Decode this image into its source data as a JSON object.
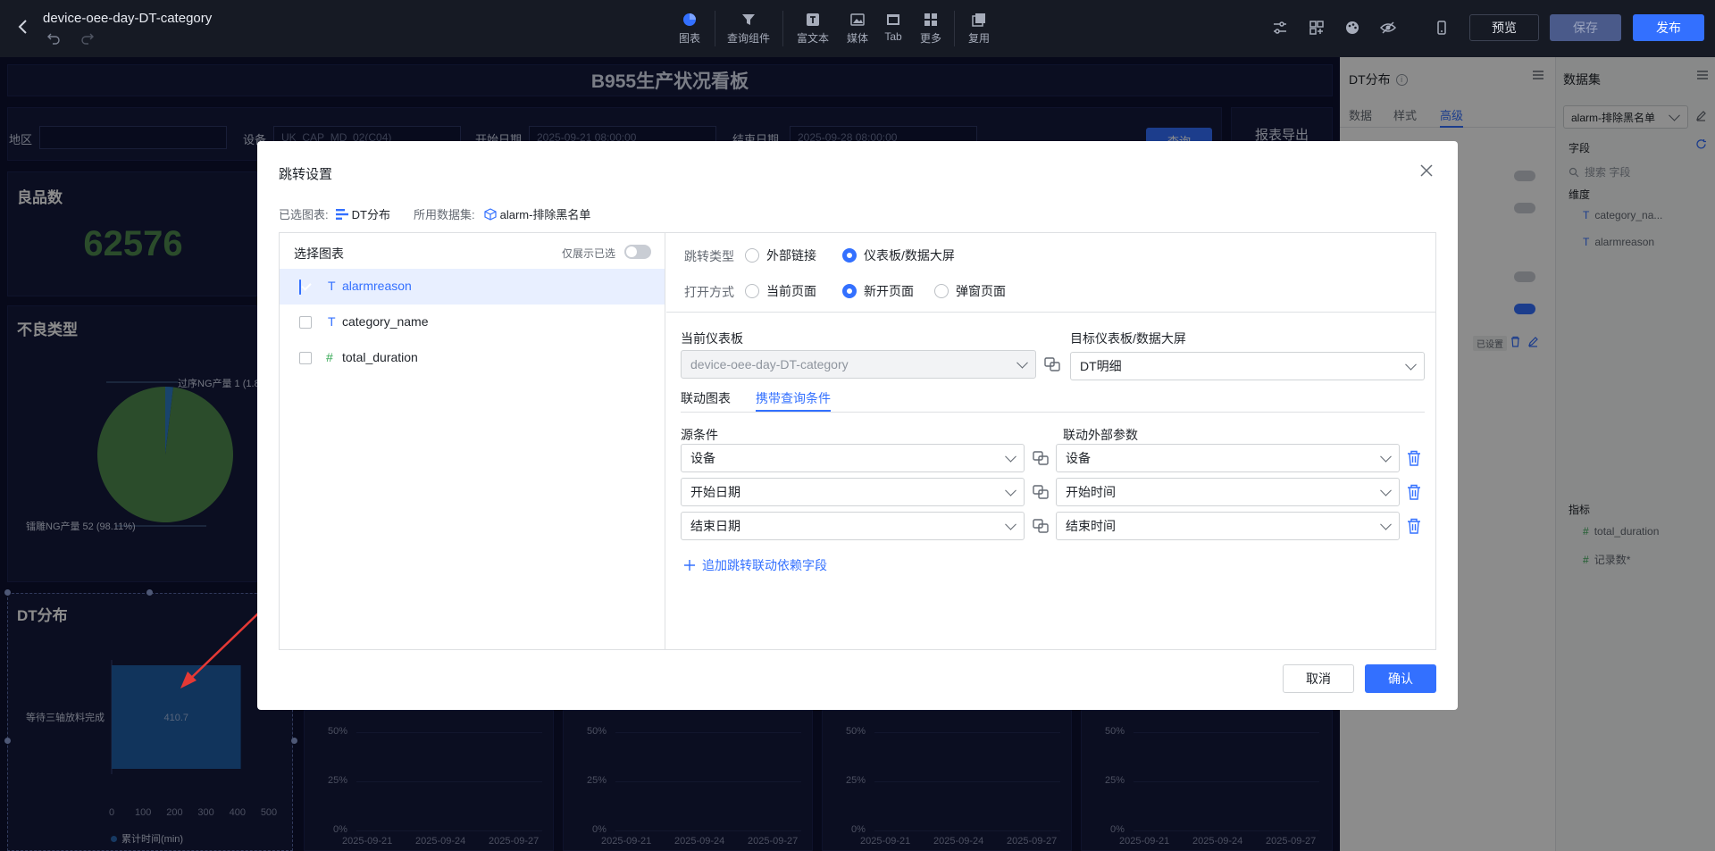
{
  "header": {
    "title": "device-oee-day-DT-category",
    "tools": [
      {
        "label": "图表",
        "icon": "chart-icon"
      },
      {
        "label": "查询组件",
        "icon": "filter-icon"
      },
      {
        "label": "富文本",
        "icon": "richtext-icon"
      },
      {
        "label": "媒体",
        "icon": "media-icon"
      },
      {
        "label": "Tab",
        "icon": "tab-icon"
      },
      {
        "label": "更多",
        "icon": "more-grid-icon"
      },
      {
        "label": "复用",
        "icon": "reuse-icon"
      }
    ],
    "preview_label": "预览",
    "save_label": "保存",
    "publish_label": "发布"
  },
  "dashboard": {
    "title": "B955生产状况看板",
    "filters": {
      "region_label": "地区",
      "device_label": "设备",
      "device_value": "UK_CAP_MD_02(C04)",
      "start_label": "开始日期",
      "start_value": "2025-09-21 08:00:00",
      "end_label": "结束日期",
      "end_value": "2025-09-28 08:00:00",
      "query_label": "查询",
      "export_label": "报表导出"
    },
    "good_count": {
      "title": "良品数",
      "value": "62576"
    },
    "defect_type": {
      "title": "不良类型",
      "label_top": "过序NG产量 1 (1.8",
      "label_bottom": "镭雕NG产量 52 (98.11%)"
    },
    "dt_dist": {
      "title": "DT分布",
      "category": "等待三轴放料完成",
      "value_label": "410.7",
      "legend": "累计时间(min)"
    },
    "small_charts": {
      "yticks": [
        "50%",
        "25%",
        "0%"
      ],
      "xticks": [
        "2025-09-21",
        "2025-09-24",
        "2025-09-27"
      ]
    }
  },
  "chart_data": [
    {
      "type": "bar",
      "title": "DT分布",
      "categories": [
        "等待三轴放料完成"
      ],
      "series": [
        {
          "name": "累计时间(min)",
          "values": [
            410.7
          ]
        }
      ],
      "xlim": [
        0,
        500
      ],
      "xticks": [
        "0",
        "100",
        "200",
        "300",
        "400",
        "500"
      ],
      "orientation": "horizontal"
    },
    {
      "type": "pie",
      "title": "不良类型",
      "categories": [
        "过序NG产量",
        "镭雕NG产量"
      ],
      "values": [
        1,
        52
      ],
      "colors": [
        "#2f7cc7",
        "#4f8a4f"
      ]
    }
  ],
  "right_panel": {
    "title": "DT分布",
    "tabs": [
      "数据",
      "样式",
      "高级"
    ],
    "active_tab": "高级",
    "set_badge": "已设置"
  },
  "dataset_panel": {
    "title": "数据集",
    "dataset": "alarm-排除黑名单",
    "fields_label": "字段",
    "search_placeholder": "搜索 字段",
    "dimension_label": "维度",
    "dimensions": [
      "category_na...",
      "alarmreason"
    ],
    "metric_label": "指标",
    "metrics": [
      "total_duration",
      "记录数*"
    ]
  },
  "modal": {
    "title": "跳转设置",
    "selected_chart_label": "已选图表:",
    "selected_chart": "DT分布",
    "dataset_label": "所用数据集:",
    "dataset_name": "alarm-排除黑名单",
    "choose_chart_label": "选择图表",
    "only_selected_label": "仅展示已选",
    "fields": [
      {
        "name": "alarmreason",
        "type": "T",
        "checked": true
      },
      {
        "name": "category_name",
        "type": "T",
        "checked": false
      },
      {
        "name": "total_duration",
        "type": "#",
        "checked": false
      }
    ],
    "jump_type_label": "跳转类型",
    "jump_types": [
      "外部链接",
      "仪表板/数据大屏"
    ],
    "open_mode_label": "打开方式",
    "open_modes": [
      "当前页面",
      "新开页面",
      "弹窗页面"
    ],
    "current_dashboard_label": "当前仪表板",
    "current_dashboard": "device-oee-day-DT-category",
    "target_label": "目标仪表板/数据大屏",
    "target_value": "DT明细",
    "subtabs": [
      "联动图表",
      "携带查询条件"
    ],
    "source_label": "源条件",
    "external_label": "联动外部参数",
    "mappings": [
      {
        "source": "设备",
        "target": "设备"
      },
      {
        "source": "开始日期",
        "target": "开始时间"
      },
      {
        "source": "结束日期",
        "target": "结束时间"
      }
    ],
    "add_label": "追加跳转联动依赖字段",
    "cancel_label": "取消",
    "confirm_label": "确认"
  }
}
